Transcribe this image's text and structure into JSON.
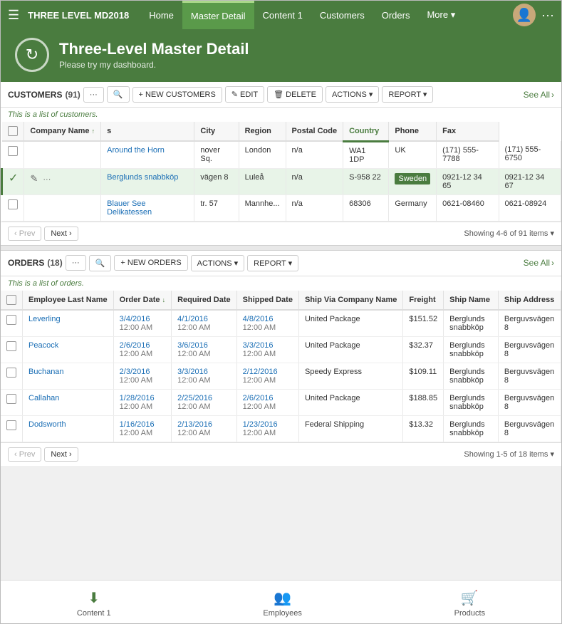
{
  "nav": {
    "hamburger": "☰",
    "app_title": "THREE LEVEL MD2018",
    "items": [
      {
        "label": "Home",
        "active": false
      },
      {
        "label": "Master Detail",
        "active": true
      },
      {
        "label": "Content 1",
        "active": false
      },
      {
        "label": "Customers",
        "active": false
      },
      {
        "label": "Orders",
        "active": false
      },
      {
        "label": "More ▾",
        "active": false
      }
    ],
    "more_dots": "···"
  },
  "header": {
    "icon": "↻",
    "title": "Three-Level Master Detail",
    "subtitle": "Please try my dashboard."
  },
  "customers": {
    "section_label": "CUSTOMERS",
    "count": "(91)",
    "description": "This is a list of customers.",
    "btn_new": "+ NEW CUSTOMERS",
    "btn_edit": "✎ EDIT",
    "btn_delete": "🗑 DELETE",
    "btn_actions": "ACTIONS ▾",
    "btn_report": "REPORT ▾",
    "btn_see_all": "See All",
    "columns": [
      {
        "label": "Company Name",
        "key": "company_name"
      },
      {
        "label": "s",
        "key": "s"
      },
      {
        "label": "City",
        "key": "city"
      },
      {
        "label": "Region",
        "key": "region"
      },
      {
        "label": "Postal Code",
        "key": "postal_code"
      },
      {
        "label": "Country",
        "key": "country",
        "sorted": true
      },
      {
        "label": "Phone",
        "key": "phone"
      },
      {
        "label": "Fax",
        "key": "fax"
      }
    ],
    "rows": [
      {
        "company_name": "Around the Horn",
        "s": "nover Sq.",
        "city": "London",
        "region": "n/a",
        "postal_code": "WA1 1DP",
        "country": "UK",
        "phone": "(171) 555-7788",
        "fax": "(171) 555-6750",
        "selected": false
      },
      {
        "company_name": "Berglunds snabbköp",
        "s": "vägen 8",
        "city": "Luleå",
        "region": "n/a",
        "postal_code": "S-958 22",
        "country": "Sweden",
        "phone": "0921-12 34 65",
        "fax": "0921-12 34 67",
        "selected": true
      },
      {
        "company_name": "Blauer See Delikatessen",
        "s": "tr. 57",
        "city": "Mannhe...",
        "region": "n/a",
        "postal_code": "68306",
        "country": "Germany",
        "phone": "0621-08460",
        "fax": "0621-08924",
        "selected": false
      }
    ],
    "pagination": {
      "prev": "‹ Prev",
      "next": "Next ›",
      "showing": "Showing 4-6 of 91 items ▾"
    }
  },
  "orders": {
    "section_label": "ORDERS",
    "count": "(18)",
    "description": "This is a list of orders.",
    "btn_new": "+ NEW ORDERS",
    "btn_actions": "ACTIONS ▾",
    "btn_report": "REPORT ▾",
    "btn_see_all": "See All",
    "columns": [
      {
        "label": "Employee Last Name",
        "key": "employee_last_name"
      },
      {
        "label": "Order Date",
        "key": "order_date",
        "sorted": true
      },
      {
        "label": "Required Date",
        "key": "required_date"
      },
      {
        "label": "Shipped Date",
        "key": "shipped_date"
      },
      {
        "label": "Ship Via Company Name",
        "key": "ship_via"
      },
      {
        "label": "Freight",
        "key": "freight"
      },
      {
        "label": "Ship Name",
        "key": "ship_name"
      },
      {
        "label": "Ship Address",
        "key": "ship_address"
      }
    ],
    "rows": [
      {
        "employee_last_name": "Leverling",
        "order_date": "3/4/2016",
        "order_date_time": "12:00 AM",
        "required_date": "4/1/2016",
        "required_date_time": "12:00 AM",
        "shipped_date": "4/8/2016",
        "shipped_date_time": "12:00 AM",
        "ship_via": "United Package",
        "freight": "$151.52",
        "ship_name": "Berglunds snabbköp",
        "ship_address": "Berguvsvägen 8"
      },
      {
        "employee_last_name": "Peacock",
        "order_date": "2/6/2016",
        "order_date_time": "12:00 AM",
        "required_date": "3/6/2016",
        "required_date_time": "12:00 AM",
        "shipped_date": "3/3/2016",
        "shipped_date_time": "12:00 AM",
        "ship_via": "United Package",
        "freight": "$32.37",
        "ship_name": "Berglunds snabbköp",
        "ship_address": "Berguvsvägen 8"
      },
      {
        "employee_last_name": "Buchanan",
        "order_date": "2/3/2016",
        "order_date_time": "12:00 AM",
        "required_date": "3/3/2016",
        "required_date_time": "12:00 AM",
        "shipped_date": "2/12/2016",
        "shipped_date_time": "12:00 AM",
        "ship_via": "Speedy Express",
        "freight": "$109.11",
        "ship_name": "Berglunds snabbköp",
        "ship_address": "Berguvsvägen 8"
      },
      {
        "employee_last_name": "Callahan",
        "order_date": "1/28/2016",
        "order_date_time": "12:00 AM",
        "required_date": "2/25/2016",
        "required_date_time": "12:00 AM",
        "shipped_date": "2/6/2016",
        "shipped_date_time": "12:00 AM",
        "ship_via": "United Package",
        "freight": "$188.85",
        "ship_name": "Berglunds snabbköp",
        "ship_address": "Berguvsvägen 8"
      },
      {
        "employee_last_name": "Dodsworth",
        "order_date": "1/16/2016",
        "order_date_time": "12:00 AM",
        "required_date": "2/13/2016",
        "required_date_time": "12:00 AM",
        "shipped_date": "1/23/2016",
        "shipped_date_time": "12:00 AM",
        "ship_via": "Federal Shipping",
        "freight": "$13.32",
        "ship_name": "Berglunds snabbköp",
        "ship_address": "Berguvsvägen 8"
      }
    ],
    "pagination": {
      "prev": "‹ Prev",
      "next": "Next ›",
      "showing": "Showing 1-5 of 18 items ▾"
    }
  },
  "bottom_nav": {
    "items": [
      {
        "label": "Content 1",
        "icon": "⬇"
      },
      {
        "label": "Employees",
        "icon": "👥"
      },
      {
        "label": "Products",
        "icon": "🛒"
      }
    ]
  }
}
